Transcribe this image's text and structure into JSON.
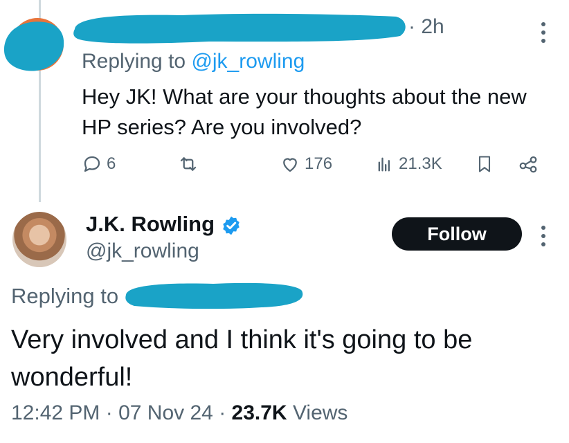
{
  "reply_tweet": {
    "time": "· 2h",
    "replying_label": "Replying to ",
    "replying_handle": "@jk_rowling",
    "text_line1": "Hey JK! What are your thoughts about the new",
    "text_line2": "HP series? Are you involved?",
    "stats": {
      "replies": "6",
      "likes": "176",
      "views": "21.3K"
    }
  },
  "main_tweet": {
    "author_name": "J.K. Rowling",
    "author_handle": "@jk_rowling",
    "follow_label": "Follow",
    "replying_label": "Replying to",
    "text_line1": "Very involved and I think it's going to be",
    "text_line2": "wonderful!",
    "time": "12:42 PM",
    "date": "07 Nov 24",
    "views_count": "23.7K",
    "views_label": "Views",
    "separator": " · "
  },
  "colors": {
    "redaction": "#1aa3c7",
    "accent": "#1d9bf0",
    "muted": "#536471"
  },
  "icons": [
    "reply-icon",
    "retweet-icon",
    "like-icon",
    "views-icon",
    "bookmark-icon",
    "share-icon",
    "more-icon",
    "verified-badge-icon"
  ]
}
